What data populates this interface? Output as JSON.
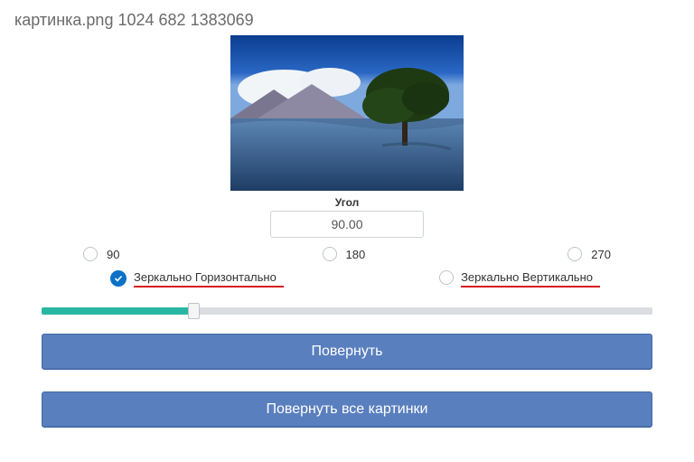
{
  "title_parts": {
    "name": "картинка.png",
    "w": "1024",
    "h": "682",
    "size": "1383069"
  },
  "angle": {
    "label": "Угол",
    "value": "90.00"
  },
  "presets": [
    "90",
    "180",
    "270"
  ],
  "mirror": {
    "horizontal": "Зеркально Горизонтально",
    "vertical": "Зеркально Вертикально",
    "horizontal_checked": true
  },
  "slider": {
    "percent": 25
  },
  "buttons": {
    "rotate": "Повернуть",
    "rotate_all": "Повернуть все картинки"
  },
  "colors": {
    "accent_blue": "#5a7fbe",
    "check_blue": "#0a71c8",
    "teal": "#29b7a3",
    "underline_red": "#d81a1a"
  }
}
